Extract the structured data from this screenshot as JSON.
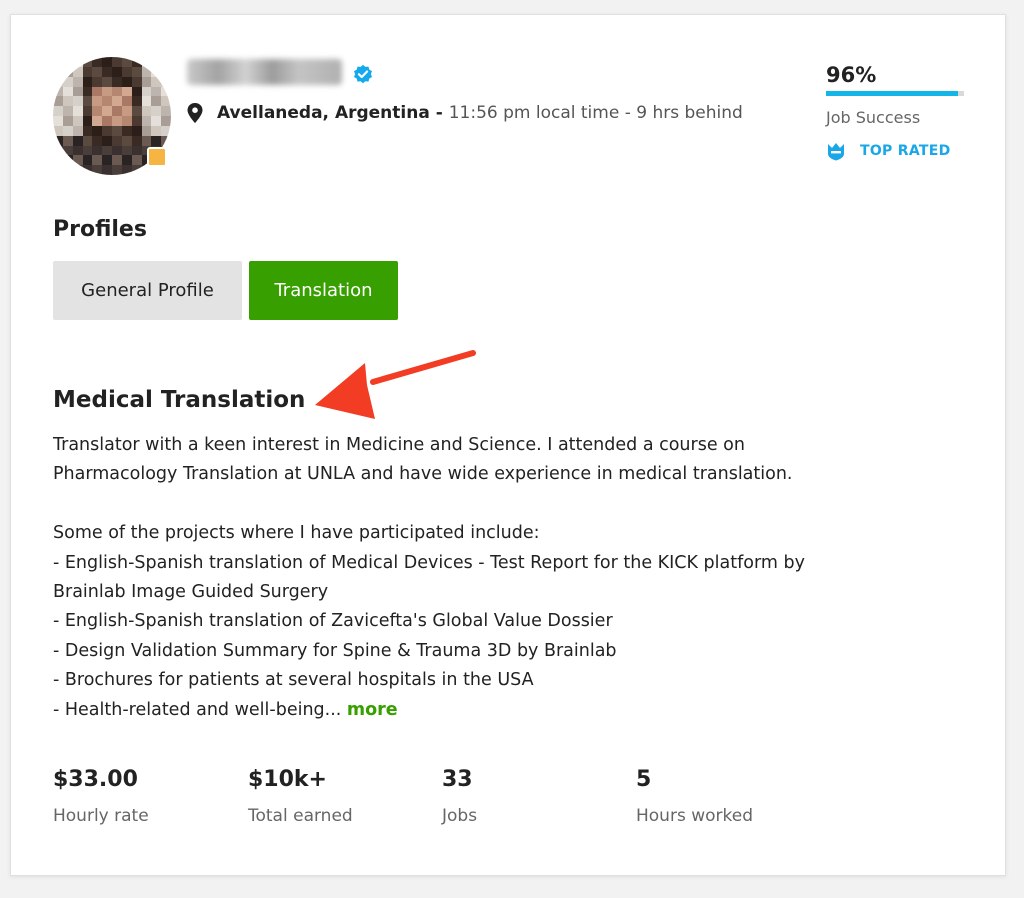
{
  "profile": {
    "location": {
      "city": "Avellaneda, Argentina",
      "separator": " - ",
      "local_time": "11:56 pm local time - 9 hrs behind"
    }
  },
  "job_success": {
    "percent_text": "96%",
    "percent_value": 96,
    "label": "Job Success",
    "badge": "TOP RATED"
  },
  "profiles": {
    "title": "Profiles",
    "tabs": [
      {
        "label": "General Profile",
        "active": false
      },
      {
        "label": "Translation",
        "active": true
      }
    ]
  },
  "section": {
    "title": "Medical Translation",
    "description_lines": [
      "Translator with a keen interest in Medicine and Science. I attended a course on",
      "Pharmacology Translation at UNLA and have wide experience in medical translation.",
      "",
      "Some of the projects where I have participated include:",
      "- English-Spanish translation of Medical Devices - Test Report for the KICK platform by",
      "Brainlab Image Guided Surgery",
      "- English-Spanish translation of Zavicefta's Global Value Dossier",
      "- Design Validation Summary for Spine & Trauma 3D by Brainlab",
      "- Brochures for patients at several hospitals in the USA"
    ],
    "last_line": "- Health-related and well-being... ",
    "more_link": "more"
  },
  "stats": [
    {
      "value": "$33.00",
      "label": "Hourly rate"
    },
    {
      "value": "$10k+",
      "label": "Total earned"
    },
    {
      "value": "33",
      "label": "Jobs"
    },
    {
      "value": "5",
      "label": "Hours worked"
    }
  ],
  "colors": {
    "accent_green": "#37a000",
    "accent_blue": "#13b6e6",
    "arrow_red": "#f23c24",
    "online_badge": "#f6b442"
  },
  "icons": {
    "verified": "verified-check-icon",
    "location": "map-pin-icon",
    "top_rated": "top-rated-crown-icon",
    "annotation": "red-arrow-icon"
  }
}
